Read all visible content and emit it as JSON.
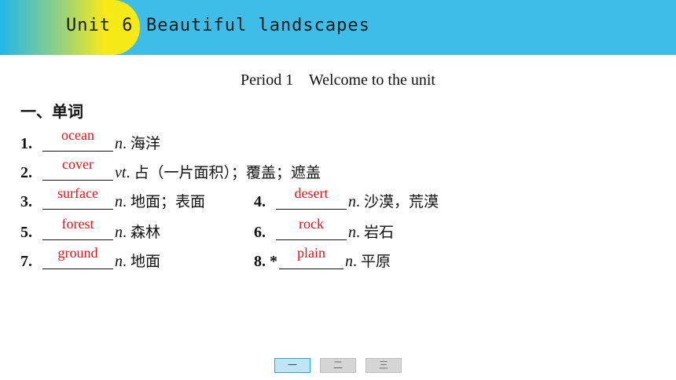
{
  "header": {
    "unit": "Unit 6",
    "title": "Beautiful landscapes"
  },
  "period_title": "Period 1    Welcome to the unit",
  "section_heading": "一、单词",
  "items": [
    {
      "num": "1",
      "answer": "ocean",
      "pos": "n",
      "meaning": "海洋"
    },
    {
      "num": "2",
      "answer": "cover",
      "pos": "vt",
      "meaning": "占（一片面积）；覆盖；遮盖"
    },
    {
      "num": "3",
      "answer": "surface",
      "pos": "n",
      "meaning": "地面；表面"
    },
    {
      "num": "4",
      "answer": "desert",
      "pos": "n",
      "meaning": "沙漠，荒漠"
    },
    {
      "num": "5",
      "answer": "forest",
      "pos": "n",
      "meaning": "森林"
    },
    {
      "num": "6",
      "answer": "rock",
      "pos": "n",
      "meaning": "岩石"
    },
    {
      "num": "7",
      "answer": "ground",
      "pos": "n",
      "meaning": "地面"
    },
    {
      "num": "8",
      "star": "*",
      "answer": "plain",
      "pos": "n",
      "meaning": "平原"
    }
  ],
  "nav": [
    "一",
    "二",
    "三"
  ],
  "colors": {
    "banner": "#3dbde8",
    "tab_yellow": "#f7ea17",
    "answer": "#e0141b"
  }
}
